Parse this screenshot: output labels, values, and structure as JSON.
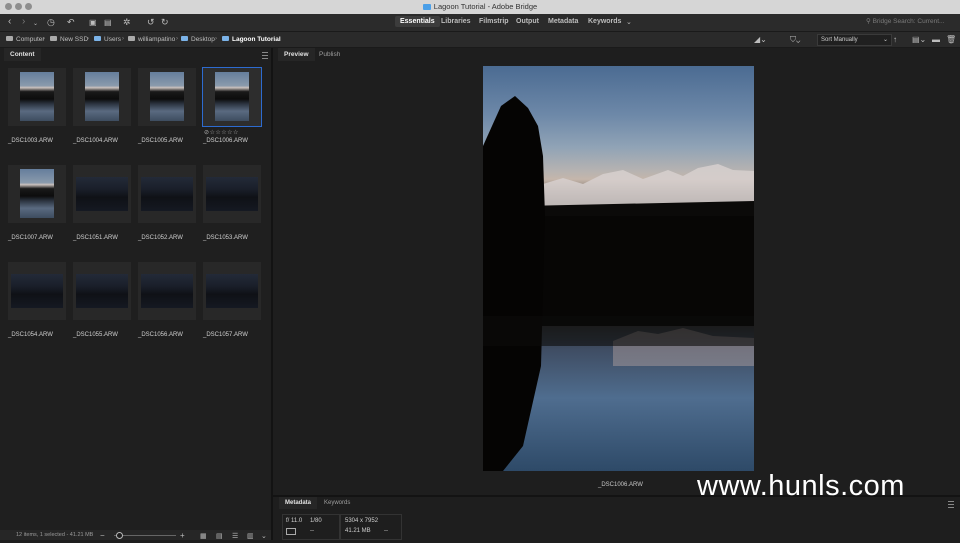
{
  "window": {
    "title": "Lagoon Tutorial - Adobe Bridge"
  },
  "workspaces": [
    "Essentials",
    "Libraries",
    "Filmstrip",
    "Output",
    "Metadata",
    "Keywords"
  ],
  "search": {
    "placeholder": "Bridge Search: Current..."
  },
  "path": [
    "Computer",
    "New SSD",
    "Users",
    "williampatino",
    "Desktop",
    "Lagoon Tutorial"
  ],
  "sort": {
    "label": "Sort Manually"
  },
  "content": {
    "tab": "Content",
    "items": [
      {
        "name": "_DSC1003.ARW",
        "orientation": "portrait"
      },
      {
        "name": "_DSC1004.ARW",
        "orientation": "portrait"
      },
      {
        "name": "_DSC1005.ARW",
        "orientation": "portrait"
      },
      {
        "name": "_DSC1006.ARW",
        "orientation": "portrait",
        "selected": true
      },
      {
        "name": "_DSC1007.ARW",
        "orientation": "portrait"
      },
      {
        "name": "_DSC1051.ARW",
        "orientation": "landscape"
      },
      {
        "name": "_DSC1052.ARW",
        "orientation": "landscape"
      },
      {
        "name": "_DSC1053.ARW",
        "orientation": "landscape"
      },
      {
        "name": "_DSC1054.ARW",
        "orientation": "landscape"
      },
      {
        "name": "_DSC1055.ARW",
        "orientation": "landscape"
      },
      {
        "name": "_DSC1056.ARW",
        "orientation": "landscape"
      },
      {
        "name": "_DSC1057.ARW",
        "orientation": "landscape"
      }
    ],
    "stars": "⊘☆☆☆☆☆",
    "status": "12 items, 1 selected - 41.21 MB"
  },
  "preview": {
    "tabs": [
      "Preview",
      "Publish"
    ],
    "caption": "_DSC1006.ARW"
  },
  "metadata": {
    "tabs": [
      "Metadata",
      "Keywords"
    ],
    "aperture": "f/ 11.0",
    "shutter": "1/80",
    "dimensions": "5304 x 7952",
    "filesize": "41.21 MB",
    "dash1": "--",
    "dash2": "--"
  },
  "watermark": "www.hunls.com",
  "colors": {
    "selection": "#2d6bd0",
    "folder": "#7bb3e8"
  }
}
